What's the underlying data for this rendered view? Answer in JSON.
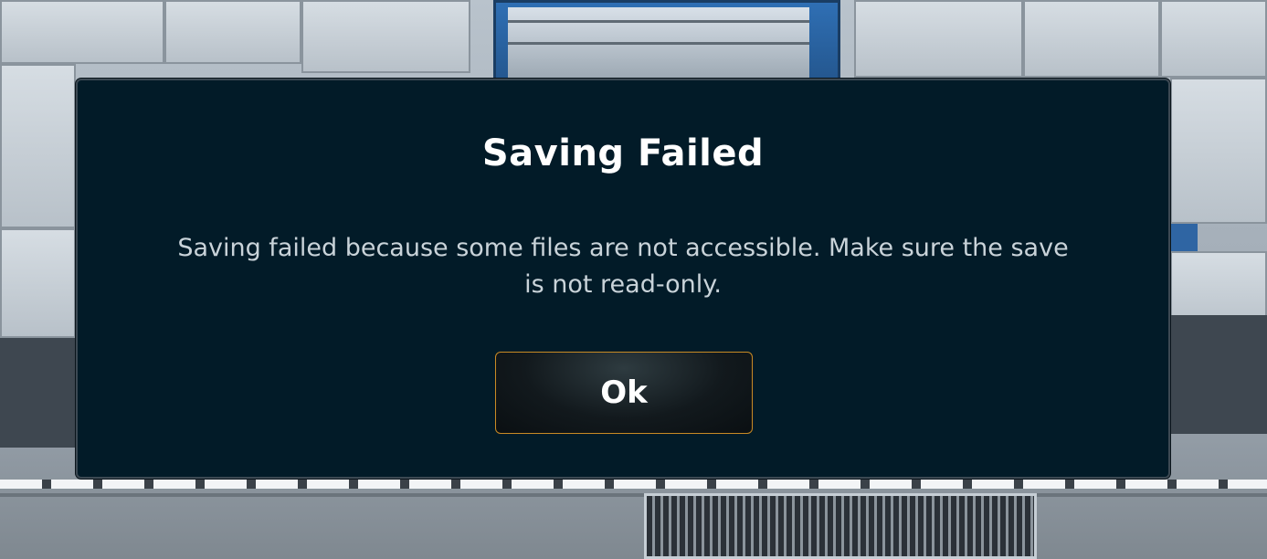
{
  "dialog": {
    "title": "Saving Failed",
    "message": "Saving failed because some files are not accessible. Make sure the save is not read-only.",
    "ok_label": "Ok"
  },
  "colors": {
    "dialog_background": "#021b28",
    "button_border": "#c98a24",
    "title_text": "#ffffff",
    "message_text": "#c9d3d9"
  }
}
